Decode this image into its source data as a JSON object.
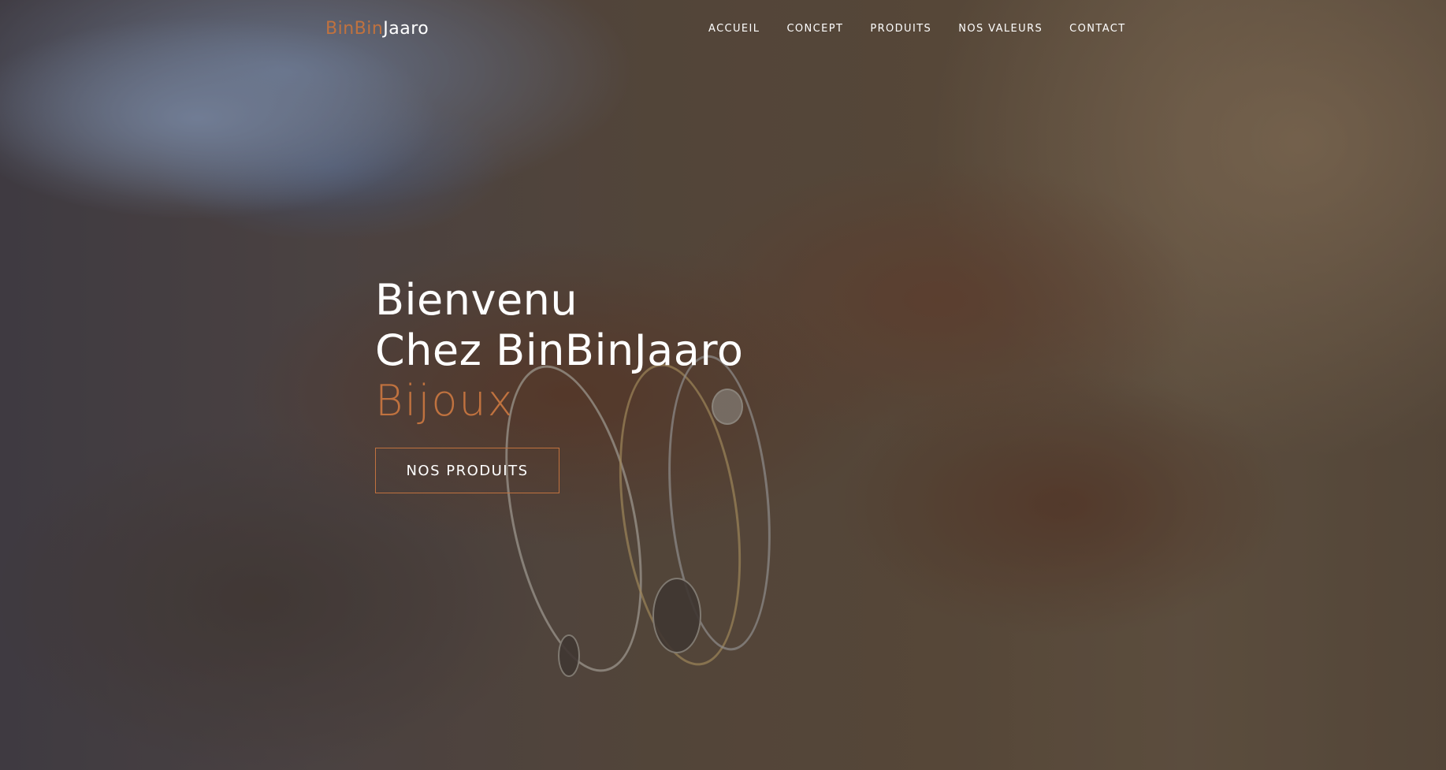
{
  "brand": {
    "logo_accent": "BinBin",
    "logo_main": "Jaaro",
    "accent_color": "#c0723f"
  },
  "nav": {
    "items": [
      {
        "label": "ACCUEIL"
      },
      {
        "label": "CONCEPT"
      },
      {
        "label": "PRODUITS"
      },
      {
        "label": "NOS VALEURS"
      },
      {
        "label": "CONTACT"
      }
    ]
  },
  "hero": {
    "line1": "Bienvenu",
    "line2": "Chez BinBinJaaro",
    "line3": "Bijoux",
    "cta_label": "NOS PRODUITS"
  }
}
